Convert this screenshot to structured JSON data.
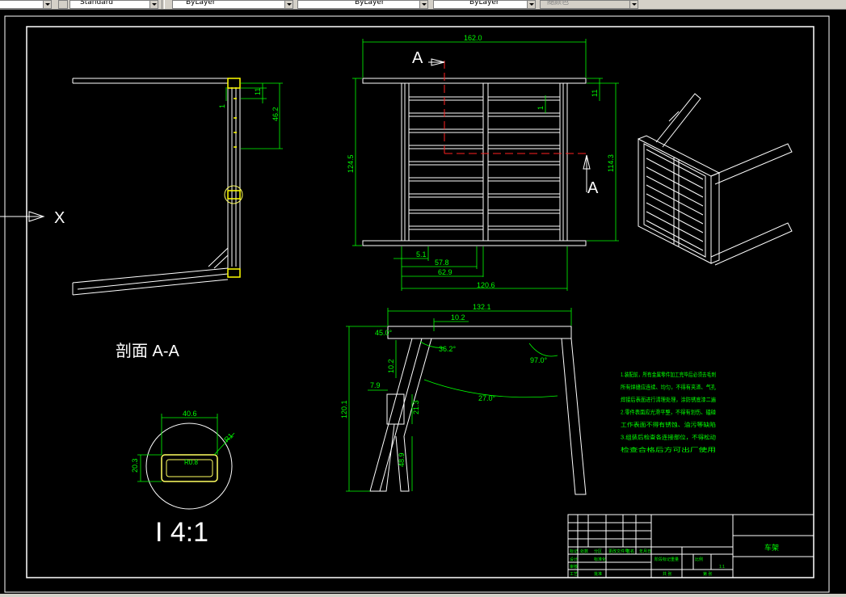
{
  "toolbar": {
    "text_style": "Standard",
    "color": "ByLayer",
    "linetype": "ByLayer",
    "lineweight": "ByLayer",
    "plot_style": "随颜色"
  },
  "drawing": {
    "section_title": "剖面 A-A",
    "scale_label": "I 4:1",
    "view_x": "X",
    "marker_a": "A",
    "top_view": {
      "dim_top": "162.0",
      "dim_left": "124.5",
      "dim_right_small": "11",
      "dim_right": "114.3",
      "dim_inner": "1",
      "dim_b1": "5.1",
      "dim_b2": "57.8",
      "dim_b3": "62.9",
      "dim_b4": "120.6"
    },
    "section_view": {
      "dim_small": "11",
      "dim_one": "1",
      "dim_height": "46.2"
    },
    "front_view": {
      "dim_top": "132.1",
      "dim_sub": "10.2",
      "angle_left": "45.0°",
      "angle_mid": "36.2°",
      "angle_right": "97.0°",
      "angle_bottom": "27.0°",
      "dim_height": "120.1",
      "dim_v1": "10.2",
      "dim_h1": "7.9",
      "dim_v2": "21.3",
      "dim_v3": "48.9"
    },
    "detail": {
      "width": "40.6",
      "height": "20.3",
      "radius": "R1",
      "inner": "R0.8"
    },
    "notes": [
      "1.装配前，所有金属零件加工完毕后必须去毛刺",
      "所有焊缝应连续、均匀，不得有夹渣、气孔",
      "焊接后表面进行清理处理，涂防锈底漆二遍",
      "2.零件表面应光滑平整，不得有划伤、磕碰",
      "工作表面不得有锈蚀、油污等缺陷",
      "3.组装后检查各连接部位，不得松动",
      "检查合格后方可出厂使用"
    ],
    "title_block": {
      "part_name": "车架",
      "cells": [
        "标记",
        "处数",
        "分区",
        "更改文件号",
        "签名",
        "年月日",
        "设计",
        "标准化",
        "阶段标记",
        "重量",
        "比例",
        "审核",
        "工艺",
        "批准",
        "共 张",
        "第 张",
        "1:1"
      ]
    }
  }
}
